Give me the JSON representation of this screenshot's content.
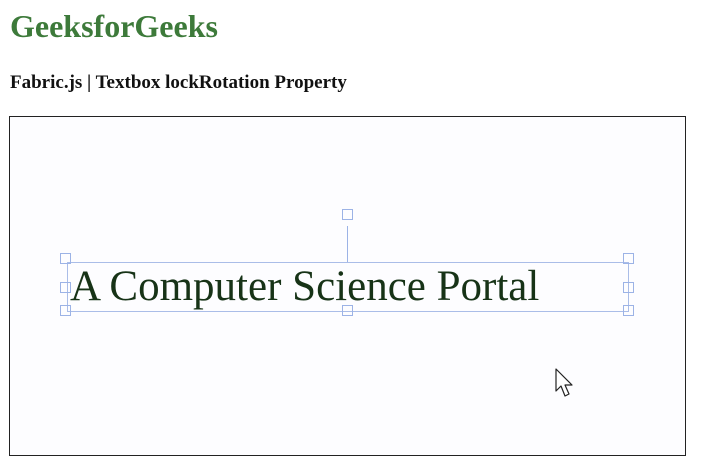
{
  "header": {
    "site_title": "GeeksforGeeks",
    "subtitle": "Fabric.js | Textbox lockRotation Property"
  },
  "canvas": {
    "textbox": {
      "text": "A Computer Science Portal"
    },
    "rotation_locked": true
  },
  "colors": {
    "site_title": "#3d7a3a",
    "text_fill": "#173317",
    "selection_border": "#aabde8",
    "canvas_border": "#222222"
  },
  "icons": {
    "pointer": "mouse-pointer-icon",
    "handles": "control-handle-icon",
    "rotation": "rotation-handle-icon"
  }
}
